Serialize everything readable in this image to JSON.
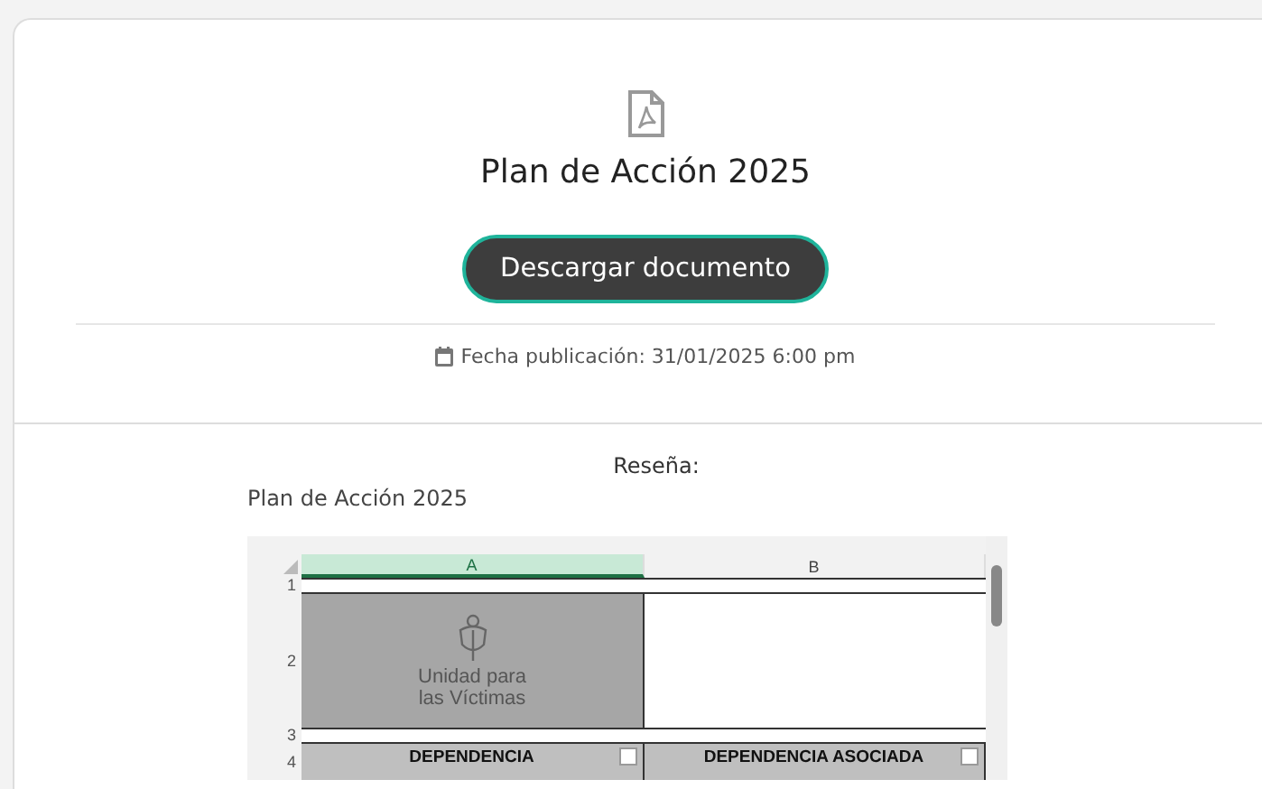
{
  "document": {
    "title": "Plan de Acción 2025",
    "download_button": "Descargar documento",
    "published": "Fecha publicación: 31/01/2025 6:00 pm"
  },
  "summary": {
    "label": "Reseña:",
    "text": "Plan de Acción 2025"
  },
  "sheet": {
    "columns": [
      {
        "label": "A",
        "selected": true
      },
      {
        "label": "B",
        "selected": false
      }
    ],
    "rows": [
      {
        "number": "1",
        "kind": "blank"
      },
      {
        "number": "2",
        "kind": "logo",
        "logo_lines": [
          "Unidad para",
          "las Víctimas"
        ]
      },
      {
        "number": "3",
        "kind": "blank"
      },
      {
        "number": "4",
        "kind": "header",
        "cells": [
          "DEPENDENCIA",
          "DEPENDENCIA ASOCIADA"
        ]
      }
    ]
  }
}
